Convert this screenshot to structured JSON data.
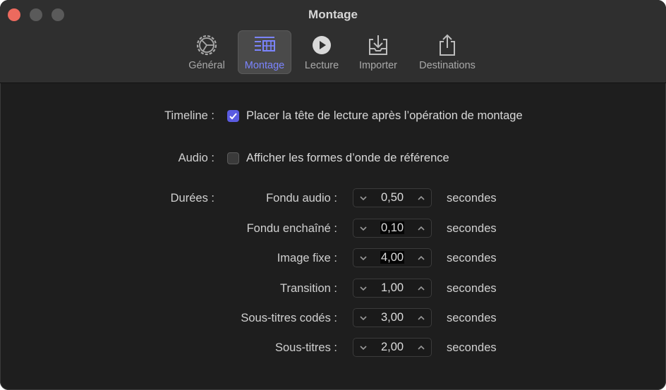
{
  "window": {
    "title": "Montage"
  },
  "tabs": [
    {
      "label": "Général",
      "icon": "gear-icon",
      "active": false
    },
    {
      "label": "Montage",
      "icon": "timeline-edit-icon",
      "active": true
    },
    {
      "label": "Lecture",
      "icon": "play-circle-icon",
      "active": false
    },
    {
      "label": "Importer",
      "icon": "import-tray-icon",
      "active": false
    },
    {
      "label": "Destinations",
      "icon": "share-icon",
      "active": false
    }
  ],
  "timeline": {
    "label": "Timeline :",
    "option": "Placer la tête de lecture après l’opération de montage",
    "checked": true
  },
  "audio": {
    "label": "Audio :",
    "option": "Afficher les formes d’onde de référence",
    "checked": false
  },
  "durations": {
    "label": "Durées :",
    "unit": "secondes",
    "items": [
      {
        "label": "Fondu audio :",
        "value": "0,50"
      },
      {
        "label": "Fondu enchaîné :",
        "value": "0,10"
      },
      {
        "label": "Image fixe :",
        "value": "4,00"
      },
      {
        "label": "Transition :",
        "value": "1,00"
      },
      {
        "label": "Sous-titres codés :",
        "value": "3,00"
      },
      {
        "label": "Sous-titres :",
        "value": "2,00"
      }
    ]
  },
  "colors": {
    "accent": "#7b84ff",
    "checkbox_on": "#5a5be0",
    "close_button": "#ec6a5e",
    "background": "#1e1e1e",
    "toolbar": "#2f2f2f"
  }
}
